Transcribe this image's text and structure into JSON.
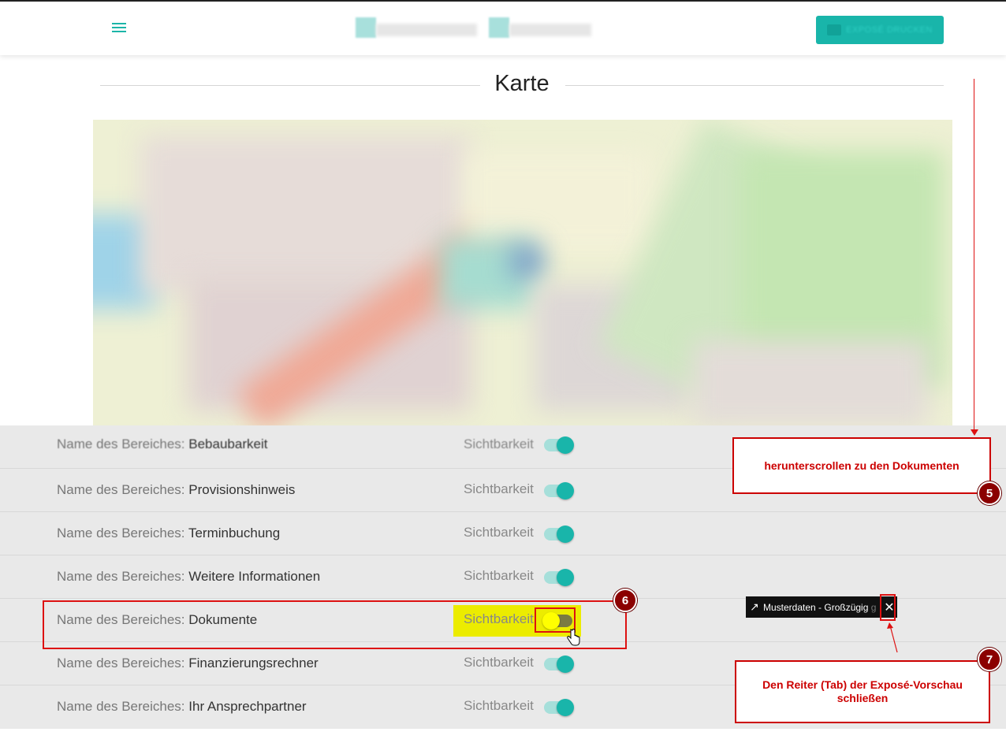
{
  "header": {
    "menu_icon": "hamburger-menu-icon",
    "print_button_label": "EXPOSÉ DRUCKEN",
    "print_icon": "printer-icon"
  },
  "section": {
    "title": "Karte"
  },
  "settings": {
    "name_prefix": "Name des Bereiches:",
    "visibility_label": "Sichtbarkeit",
    "rows": [
      {
        "name": "Bebaubarkeit",
        "visible": true
      },
      {
        "name": "Provisionshinweis",
        "visible": true
      },
      {
        "name": "Terminbuchung",
        "visible": true
      },
      {
        "name": "Weitere Informationen",
        "visible": true
      },
      {
        "name": "Dokumente",
        "visible": false
      },
      {
        "name": "Finanzierungsrechner",
        "visible": true
      },
      {
        "name": "Ihr Ansprechpartner",
        "visible": true
      }
    ]
  },
  "annotations": {
    "step5": {
      "number": "5",
      "text": "herunterscrollen zu den Dokumenten"
    },
    "step6": {
      "number": "6"
    },
    "step7": {
      "number": "7",
      "text": "Den Reiter (Tab) der Exposé-Vorschau schließen"
    },
    "accent_color": "#cc0000"
  },
  "browser_tab": {
    "title": "Musterdaten - Großzügig",
    "title_overflow": "g",
    "close_symbol": "✕",
    "tab_icon": "external-link-arrow-icon"
  },
  "colors": {
    "brand": "#19b5aa",
    "highlight": "#ecec00"
  }
}
